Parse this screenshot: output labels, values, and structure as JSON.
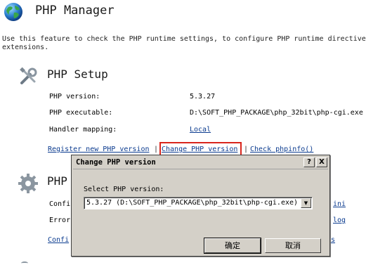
{
  "header": {
    "title": "PHP Manager",
    "description_line1": "Use this feature to check the PHP runtime settings, to configure PHP runtime directive",
    "description_line2": "extensions."
  },
  "setup": {
    "title": "PHP Setup",
    "rows": [
      {
        "label": "PHP version:",
        "value": "5.3.27"
      },
      {
        "label": "PHP executable:",
        "value": "D:\\SOFT_PHP_PACKAGE\\php_32bit\\php-cgi.exe"
      },
      {
        "label": "Handler mapping:",
        "value": "Local"
      }
    ],
    "links": {
      "register": "Register new PHP version",
      "change": "Change PHP version",
      "check": "Check phpinfo()"
    },
    "separator": "|"
  },
  "settings": {
    "title_partial": "PHP",
    "row1_partial": "Confi",
    "row2_partial": "Error",
    "link_partial": "Confi",
    "right_link1_partial": "ini",
    "right_link2_partial": "log",
    "right_link3_partial": "s"
  },
  "dialog": {
    "title": "Change PHP version",
    "help_button": "?",
    "close_button": "X",
    "select_label": "Select PHP version:",
    "selected_value": "5.3.27 (D:\\SOFT_PHP_PACKAGE\\php_32bit\\php-cgi.exe)",
    "ok_label": "确定",
    "cancel_label": "取消"
  },
  "colors": {
    "link": "#0b3b8f",
    "highlight": "#d9251c",
    "dialog_bg": "#d4d0c8"
  },
  "icons": {
    "header": "globe-icon",
    "setup": "tools-icon",
    "settings": "gear-icon"
  }
}
